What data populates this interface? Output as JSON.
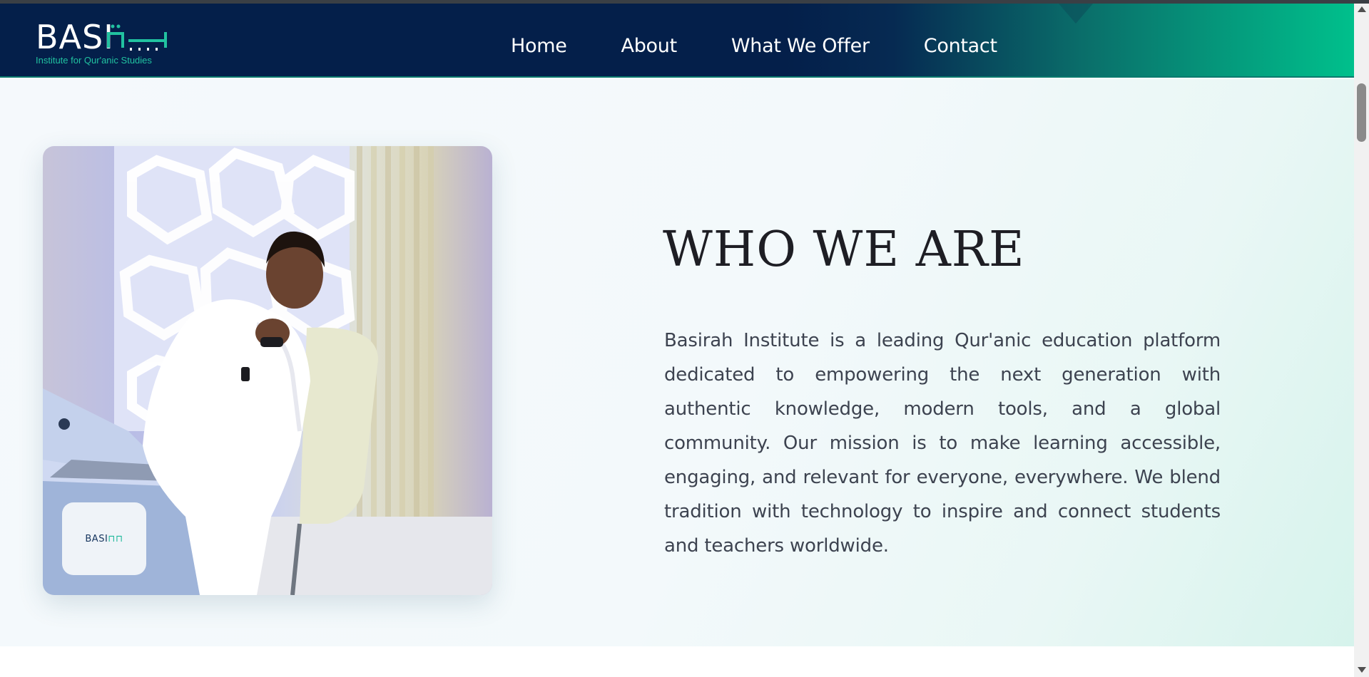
{
  "header": {
    "logo": {
      "text_left": "BASI",
      "tagline": "Institute for Qur'anic Studies"
    },
    "nav": [
      {
        "label": "Home"
      },
      {
        "label": "About"
      },
      {
        "label": "What We Offer"
      },
      {
        "label": "Contact"
      }
    ]
  },
  "about": {
    "heading": "WHO WE ARE",
    "body": "Basirah Institute is a leading Qur'anic education platform dedicated to empowering the next generation with authentic knowledge, modern tools, and a global community. Our mission is to make learning accessible, engaging, and relevant for everyone, everywhere. We blend tradition with technology to inspire and connect students and teachers worldwide.",
    "photo_badge": {
      "text_left": "BASI"
    }
  },
  "colors": {
    "nav_dark": "#041f4a",
    "nav_accent": "#00c08c",
    "heading": "#1e1e24",
    "body_text": "#3d4350",
    "hero_bg": "#f3f9fb"
  },
  "icons": [
    "logo-mark-icon",
    "scroll-up-arrow-icon",
    "scroll-down-arrow-icon"
  ]
}
